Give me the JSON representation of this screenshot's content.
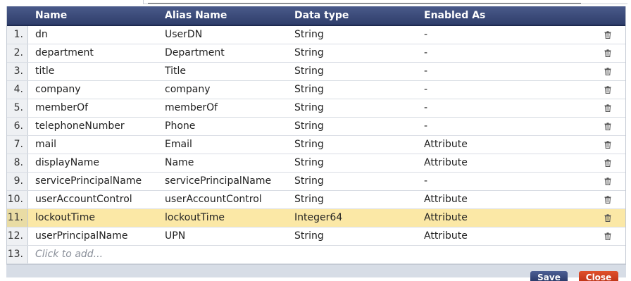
{
  "columns": {
    "name": "Name",
    "alias": "Alias Name",
    "type": "Data type",
    "enabled": "Enabled As"
  },
  "rows": [
    {
      "num": "1.",
      "name": "dn",
      "alias": "UserDN",
      "type": "String",
      "enabled": "-"
    },
    {
      "num": "2.",
      "name": "department",
      "alias": "Department",
      "type": "String",
      "enabled": "-"
    },
    {
      "num": "3.",
      "name": "title",
      "alias": "Title",
      "type": "String",
      "enabled": "-"
    },
    {
      "num": "4.",
      "name": "company",
      "alias": "company",
      "type": "String",
      "enabled": "-"
    },
    {
      "num": "5.",
      "name": "memberOf",
      "alias": "memberOf",
      "type": "String",
      "enabled": "-"
    },
    {
      "num": "6.",
      "name": "telephoneNumber",
      "alias": "Phone",
      "type": "String",
      "enabled": "-"
    },
    {
      "num": "7.",
      "name": "mail",
      "alias": "Email",
      "type": "String",
      "enabled": "Attribute"
    },
    {
      "num": "8.",
      "name": "displayName",
      "alias": "Name",
      "type": "String",
      "enabled": "Attribute"
    },
    {
      "num": "9.",
      "name": "servicePrincipalName",
      "alias": "servicePrincipalName",
      "type": "String",
      "enabled": "-"
    },
    {
      "num": "10.",
      "name": "userAccountControl",
      "alias": "userAccountControl",
      "type": "String",
      "enabled": "Attribute"
    },
    {
      "num": "11.",
      "name": "lockoutTime",
      "alias": "lockoutTime",
      "type": "Integer64",
      "enabled": "Attribute",
      "selected": true
    },
    {
      "num": "12.",
      "name": "userPrincipalName",
      "alias": "UPN",
      "type": "String",
      "enabled": "Attribute"
    }
  ],
  "add_row": {
    "num": "13.",
    "placeholder": "Click to add..."
  },
  "buttons": {
    "save": "Save",
    "close": "Close"
  },
  "icons": {
    "delete": "trash-icon"
  },
  "colors": {
    "header": "#2f3e6b",
    "selected_row": "#fbe8a6",
    "save_button": "#2c3c6c",
    "close_button": "#c2371a"
  }
}
